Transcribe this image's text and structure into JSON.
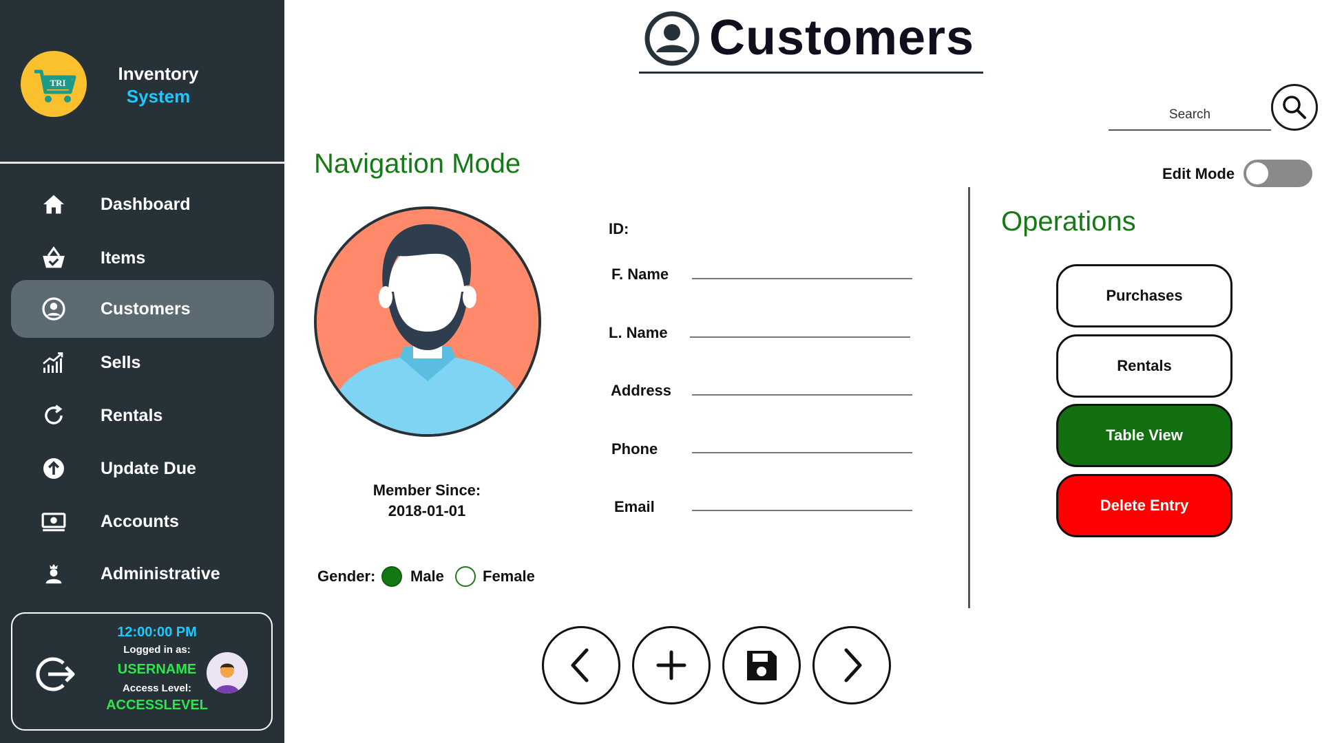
{
  "app": {
    "brand_line1": "Inventory",
    "brand_line2": "System",
    "logo_text": "TRI"
  },
  "sidebar": {
    "items": [
      {
        "label": "Dashboard",
        "icon": "home-icon"
      },
      {
        "label": "Items",
        "icon": "basket-check-icon"
      },
      {
        "label": "Customers",
        "icon": "account-circle-icon",
        "active": true
      },
      {
        "label": "Sells",
        "icon": "chart-growth-icon"
      },
      {
        "label": "Rentals",
        "icon": "refresh-icon"
      },
      {
        "label": "Update Due",
        "icon": "arrow-up-circle-icon"
      },
      {
        "label": "Accounts",
        "icon": "cash-icon"
      },
      {
        "label": "Administrative",
        "icon": "admin-user-icon"
      }
    ]
  },
  "status": {
    "time": "12:00:00 PM",
    "logged_in_label": "Logged in as:",
    "username": "USERNAME",
    "access_label": "Access Level:",
    "access_level": "ACCESSLEVEL"
  },
  "header": {
    "title": "Customers",
    "search_placeholder": "Search",
    "edit_mode_label": "Edit Mode",
    "edit_mode_on": false
  },
  "main": {
    "mode_title": "Navigation Mode",
    "member_since_label": "Member Since:",
    "member_since_date": "2018-01-01",
    "gender_label": "Gender:",
    "gender_options": [
      "Male",
      "Female"
    ],
    "gender_selected": "Male",
    "fields": {
      "id": {
        "label": "ID:",
        "value": ""
      },
      "fname": {
        "label": "F. Name",
        "value": ""
      },
      "lname": {
        "label": "L. Name",
        "value": ""
      },
      "address": {
        "label": "Address",
        "value": ""
      },
      "phone": {
        "label": "Phone",
        "value": ""
      },
      "email": {
        "label": "Email",
        "value": ""
      }
    }
  },
  "operations": {
    "title": "Operations",
    "buttons": [
      {
        "label": "Purchases",
        "style": "outline"
      },
      {
        "label": "Rentals",
        "style": "outline"
      },
      {
        "label": "Table View",
        "style": "green"
      },
      {
        "label": "Delete Entry",
        "style": "red"
      }
    ]
  },
  "record_nav": {
    "buttons": [
      "chevron-left-icon",
      "plus-icon",
      "save-icon",
      "chevron-right-icon"
    ]
  },
  "colors": {
    "sidebar_bg": "#263238",
    "sidebar_active": "#5c6b72",
    "accent_green": "#157a15",
    "delete_red": "#ff0000",
    "brand_blue": "#1ec8ff",
    "status_green": "#2ee64c"
  }
}
